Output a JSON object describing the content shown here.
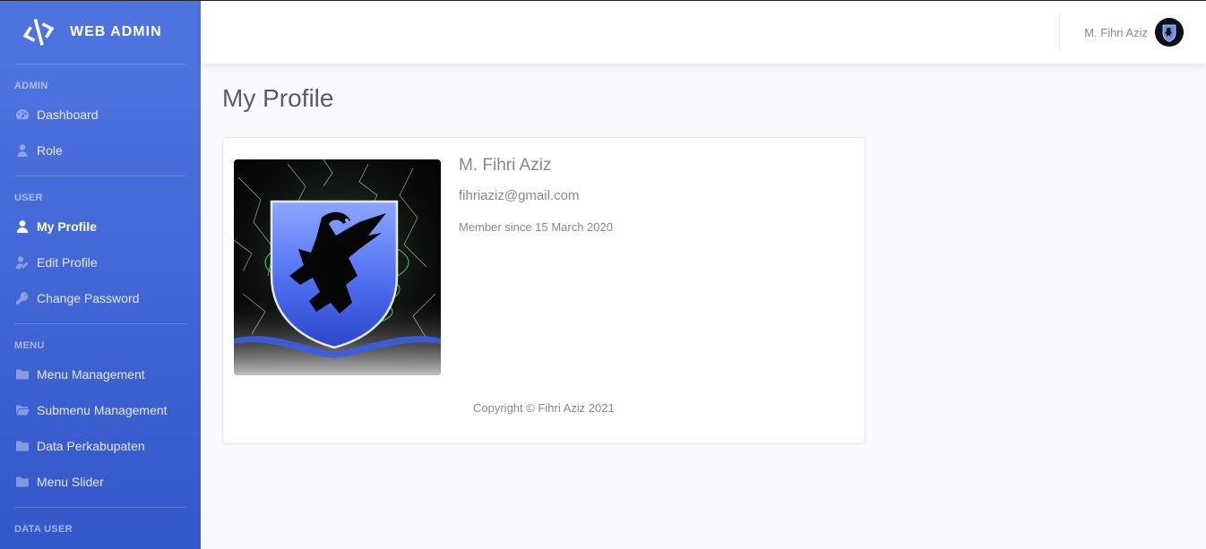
{
  "brand": {
    "name": "WEB ADMIN"
  },
  "sidebar": {
    "sections": [
      {
        "heading": "ADMIN",
        "items": [
          {
            "label": "Dashboard",
            "icon": "dashboard-icon"
          },
          {
            "label": "Role",
            "icon": "user-tie-icon"
          }
        ]
      },
      {
        "heading": "USER",
        "items": [
          {
            "label": "My Profile",
            "icon": "user-icon",
            "active": true
          },
          {
            "label": "Edit Profile",
            "icon": "user-edit-icon"
          },
          {
            "label": "Change Password",
            "icon": "key-icon"
          }
        ]
      },
      {
        "heading": "MENU",
        "items": [
          {
            "label": "Menu Management",
            "icon": "folder-icon"
          },
          {
            "label": "Submenu Management",
            "icon": "folder-open-icon"
          },
          {
            "label": "Data Perkabupaten",
            "icon": "folder-icon"
          },
          {
            "label": "Menu Slider",
            "icon": "folder-icon"
          }
        ]
      },
      {
        "heading": "DATA USER",
        "items": []
      }
    ]
  },
  "topbar": {
    "user_name": "M. Fihri Aziz"
  },
  "main": {
    "page_title": "My Profile",
    "profile": {
      "name": "M. Fihri Aziz",
      "email": "fihriaziz@gmail.com",
      "member_since": "Member since 15 March 2020"
    },
    "copyright": "Copyright © Fihri Aziz 2021"
  },
  "colors": {
    "sidebar_gradient_top": "#4e73df",
    "sidebar_gradient_bottom": "#3457c9",
    "background": "#f8f9fc",
    "text_muted": "#858796"
  }
}
